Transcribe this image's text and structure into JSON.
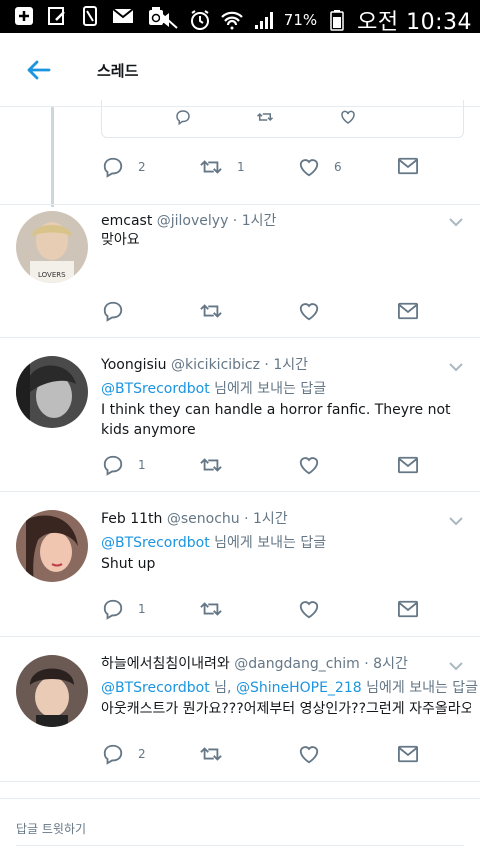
{
  "status_bar": {
    "battery_percent": "71%",
    "clock": "오전 10:34",
    "left_icons": [
      "plus-icon",
      "edit-icon",
      "phone-icon",
      "mail-icon",
      "recycle-icon"
    ],
    "right_icons": [
      "mute-icon",
      "alarm-icon",
      "wifi-icon",
      "signal-icon",
      "battery-icon"
    ]
  },
  "header": {
    "title": "스레드"
  },
  "colors": {
    "accent": "#1b95e0",
    "muted": "#657786",
    "text": "#14171a",
    "divider": "#e6ecf0"
  },
  "top_tweet_actions": {
    "reply_count": "2",
    "retweet_count": "1",
    "like_count": "6"
  },
  "tweets": [
    {
      "display_name": "emcast",
      "meta": "@jilovelyy · 1시간",
      "reply_to": "",
      "reply_suffix": "",
      "text": "맞아요",
      "reply_count": ""
    },
    {
      "display_name": "Yoongisiu",
      "meta": "@kicikicibicz · 1시간",
      "reply_to": "@BTSrecordbot",
      "reply_suffix": " 님에게 보내는 답글",
      "text": "I think they can handle a horror fanfic. Theyre not kids anymore",
      "reply_count": "1"
    },
    {
      "display_name": "Feb 11th",
      "meta": "@senochu · 1시간",
      "reply_to": "@BTSrecordbot",
      "reply_suffix": " 님에게 보내는 답글",
      "text": "Shut up",
      "reply_count": "1"
    },
    {
      "display_name": "하늘에서침침이내려와",
      "meta": "@dangdang_chim · 8시간",
      "reply_to": "@BTSrecordbot",
      "reply_mid": " 님, ",
      "reply_to_2": "@ShineHOPE_218",
      "reply_suffix": " 님에게 보내는 답글",
      "text": "아웃캐스트가 뭔가요???어제부터 영상인가??그런게 자주올라오던뎅...",
      "reply_count": "2"
    }
  ],
  "footer": {
    "reply_prompt": "답글 트윗하기"
  }
}
